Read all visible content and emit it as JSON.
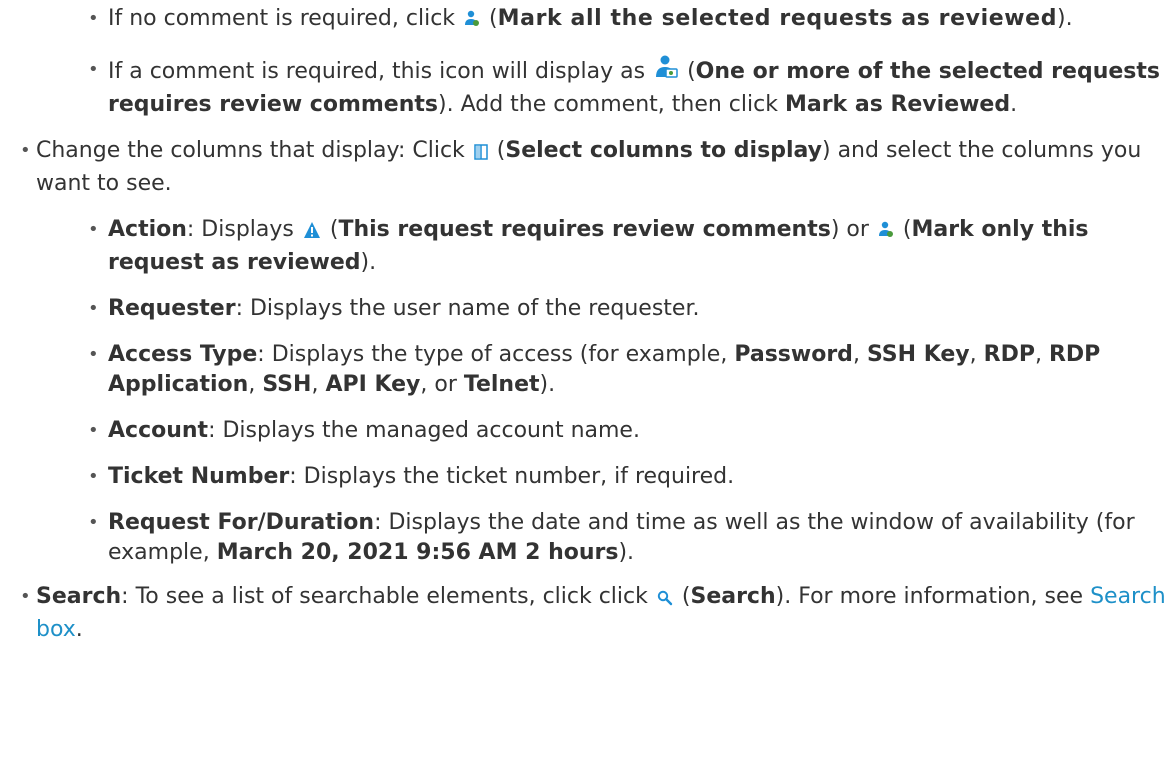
{
  "sub_top": [
    {
      "pre": "If no comment is required, click",
      "post_open": "(",
      "bold": "Mark all the selected requests as  reviewed",
      "post_close": ")."
    },
    {
      "pre": "If a comment is required, this icon will display as",
      "post_open": "(",
      "bold": "One or more of the selected requests requires review comments",
      "mid": "). Add the comment, then click",
      "bold2": "Mark as Reviewed",
      "end": "."
    }
  ],
  "columns": {
    "pre": "Change the columns that display: Click",
    "open": "(",
    "bold": "Select columns to display",
    "post": ") and select the columns you want to see."
  },
  "column_items": {
    "action": {
      "label": "Action",
      "t1": ": Displays",
      "open1": "(",
      "b1": "This request requires review comments",
      "t2": ") or",
      "open2": "(",
      "b2": "Mark only this request as reviewed",
      "end": ")."
    },
    "requester": {
      "label": "Requester",
      "text": ": Displays the user name of the requester."
    },
    "access_type": {
      "label": "Access Type",
      "text": ": Displays the type of access (for example,",
      "v1": "Password",
      "v2": "SSH Key",
      "v3": "RDP",
      "v4": "RDP Application",
      "v5": "SSH",
      "v6": "API Key",
      "or": ", or",
      "v7": "Telnet",
      "end": ")."
    },
    "account": {
      "label": "Account",
      "text": ": Displays the managed account name."
    },
    "ticket": {
      "label": "Ticket Number",
      "text": ": Displays the ticket number, if required."
    },
    "request_for": {
      "label": "Request For/Duration",
      "text": ": Displays the date and time as well as the window of availability (for example,",
      "example": "March 20, 2021 9:56 AM 2 hours",
      "end": ")."
    }
  },
  "search": {
    "label": "Search",
    "text": ": To see a list of searchable elements, click click",
    "open": "(",
    "bold": "Search",
    "post": "). For more information, see",
    "link": "Search box",
    "end": "."
  },
  "colors": {
    "text": "#333333",
    "link": "#1e90c8",
    "icon_blue": "#1f8fd6",
    "icon_warn": "#1f8fd6"
  }
}
